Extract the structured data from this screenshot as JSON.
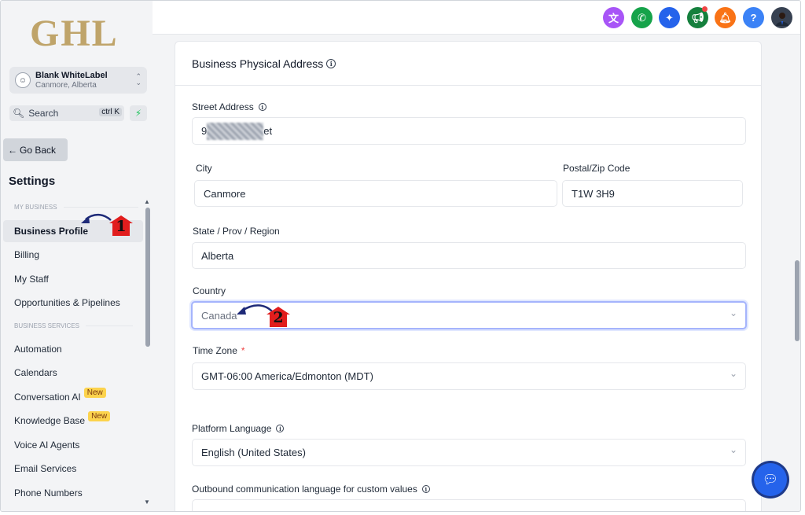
{
  "logo": {
    "text": "GHL"
  },
  "account": {
    "name": "Blank WhiteLabel",
    "location": "Canmore, Alberta"
  },
  "search": {
    "label": "Search",
    "shortcut": "ctrl K"
  },
  "nav": {
    "go_back": "Go Back",
    "settings_title": "Settings",
    "section_my_business": "MY BUSINESS",
    "section_business_services": "BUSINESS SERVICES",
    "items": [
      {
        "label": "Business Profile",
        "active": true
      },
      {
        "label": "Billing"
      },
      {
        "label": "My Staff"
      },
      {
        "label": "Opportunities & Pipelines"
      },
      {
        "label": "Automation"
      },
      {
        "label": "Calendars"
      },
      {
        "label": "Conversation AI",
        "badge": "New"
      },
      {
        "label": "Knowledge Base",
        "badge": "New"
      },
      {
        "label": "Voice AI Agents"
      },
      {
        "label": "Email Services"
      },
      {
        "label": "Phone Numbers"
      }
    ]
  },
  "topbar": {
    "icons": [
      "translate-icon",
      "phone-icon",
      "sparkle-icon",
      "megaphone-icon",
      "bell-icon",
      "help-icon",
      "user-avatar"
    ],
    "help_label": "?",
    "colors": {
      "translate": "#a855f7",
      "phone": "#16a34a",
      "sparkle": "#2563eb",
      "megaphone": "#15803d",
      "bell": "#f97316",
      "help": "#3b82f6"
    }
  },
  "form": {
    "section_title": "Business Physical Address",
    "street_label": "Street Address",
    "street_value_start": "9",
    "street_value_end": "et",
    "city_label": "City",
    "city_value": "Canmore",
    "postal_label": "Postal/Zip Code",
    "postal_value": "T1W 3H9",
    "state_label": "State / Prov / Region",
    "state_value": "Alberta",
    "country_label": "Country",
    "country_value": "Canada",
    "timezone_label": "Time Zone",
    "timezone_required": "*",
    "timezone_value": "GMT-06:00 America/Edmonton (MDT)",
    "platform_lang_label": "Platform Language",
    "platform_lang_value": "English (United States)",
    "outbound_lang_label": "Outbound communication language for custom values",
    "outbound_lang_value": ""
  },
  "annotations": [
    {
      "number": "1",
      "target": "Business Profile"
    },
    {
      "number": "2",
      "target": "Country"
    }
  ]
}
